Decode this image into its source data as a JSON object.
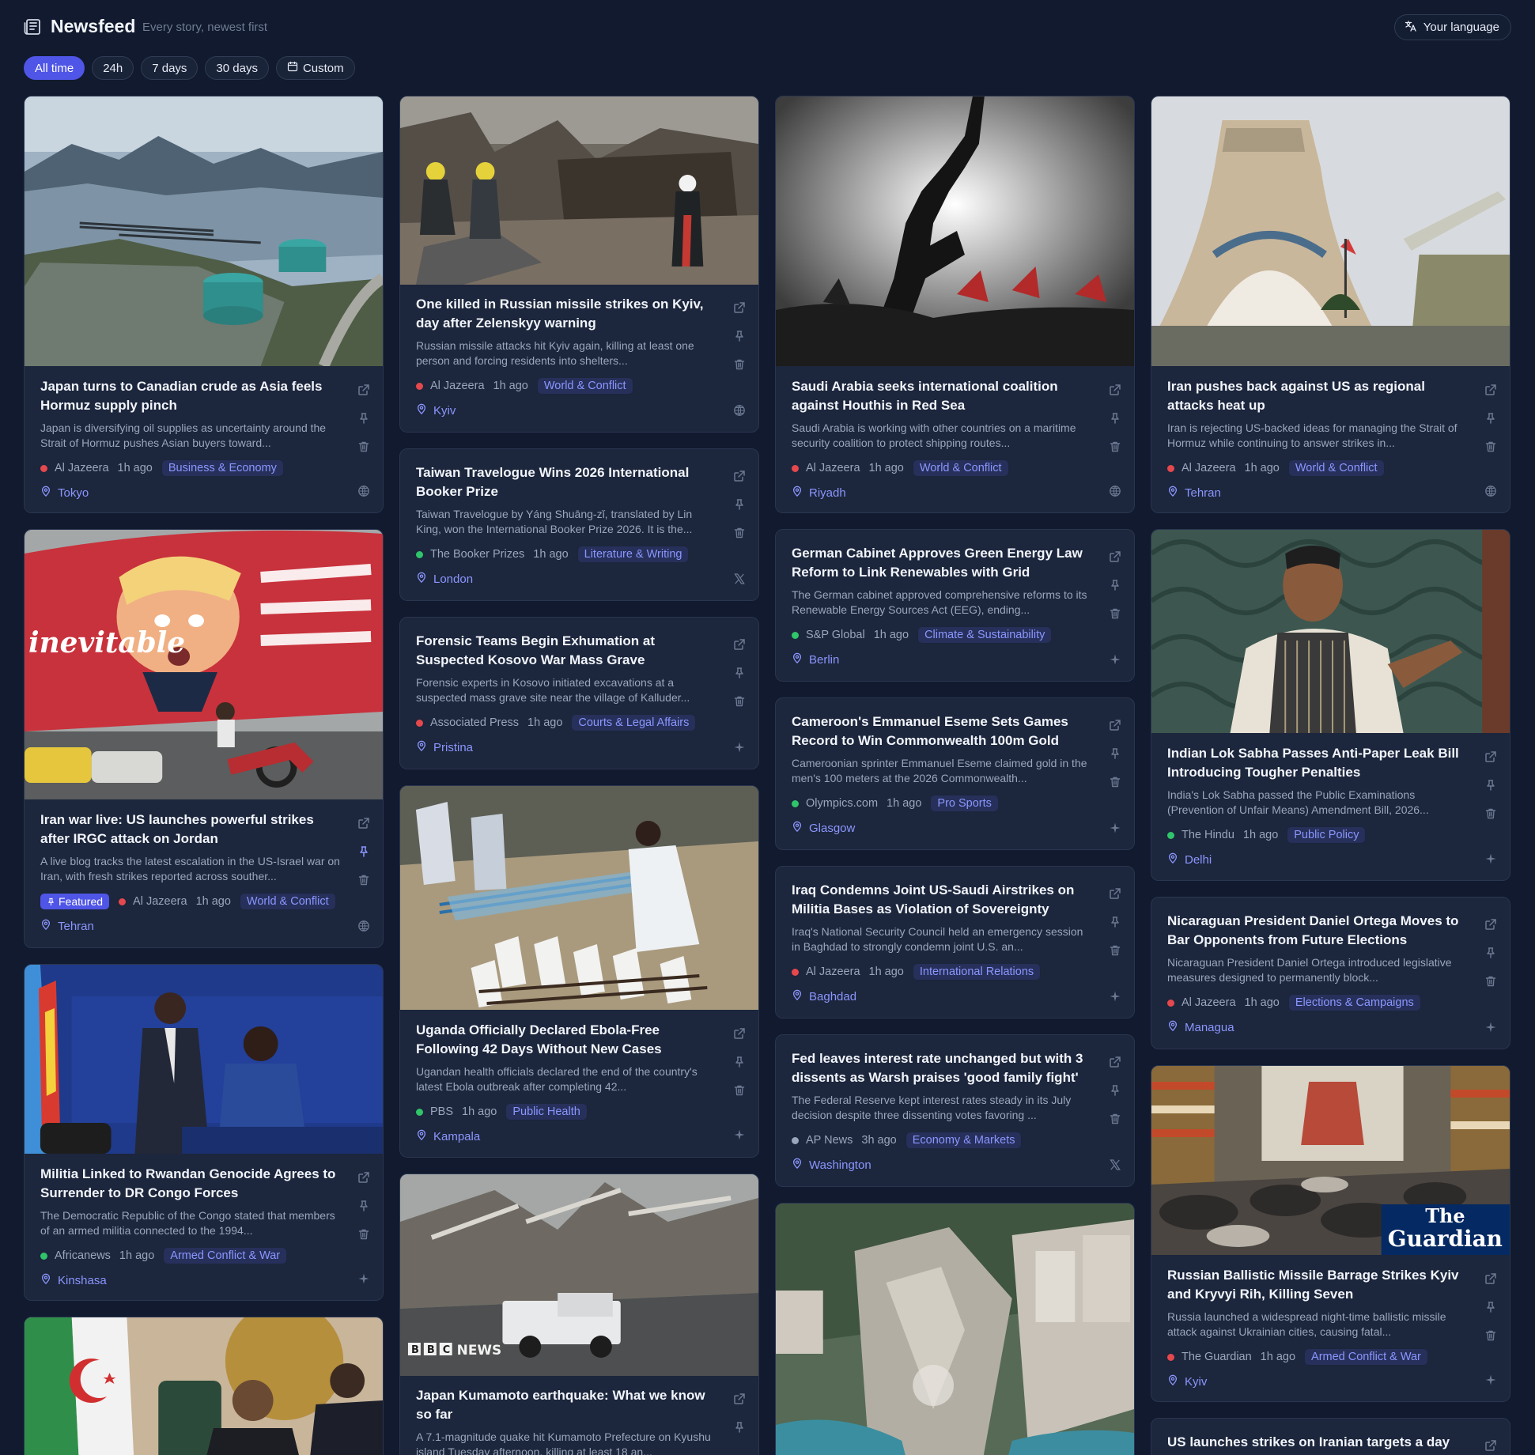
{
  "header": {
    "title": "Newsfeed",
    "subtitle": "Every story, newest first",
    "language_button": "Your language"
  },
  "filters": [
    "All time",
    "24h",
    "7 days",
    "30 days",
    "Custom"
  ],
  "active_filter": "All time",
  "cards": [
    {
      "title": "Japan turns to Canadian crude as Asia feels Hormuz supply pinch",
      "summary": "Japan is diversifying oil supplies as uncertainty around the Strait of Hormuz pushes Asian buyers toward...",
      "source": "Al Jazeera",
      "time": "1h ago",
      "category": "Business & Economy",
      "location": "Tokyo",
      "dot": "#e5484d"
    },
    {
      "title": "One killed in Russian missile strikes on Kyiv, day after Zelenskyy warning",
      "summary": "Russian missile attacks hit Kyiv again, killing at least one person and forcing residents into shelters...",
      "source": "Al Jazeera",
      "time": "1h ago",
      "category": "World & Conflict",
      "location": "Kyiv",
      "dot": "#e5484d"
    },
    {
      "title": "Saudi Arabia seeks international coalition against Houthis in Red Sea",
      "summary": "Saudi Arabia is working with other countries on a maritime security coalition to protect shipping routes...",
      "source": "Al Jazeera",
      "time": "1h ago",
      "category": "World & Conflict",
      "location": "Riyadh",
      "dot": "#e5484d"
    },
    {
      "title": "Iran pushes back against US as regional attacks heat up",
      "summary": "Iran is rejecting US-backed ideas for managing the Strait of Hormuz while continuing to answer strikes in...",
      "source": "Al Jazeera",
      "time": "1h ago",
      "category": "World & Conflict",
      "location": "Tehran",
      "dot": "#e5484d"
    },
    {
      "title": "Taiwan Travelogue Wins 2026 International Booker Prize",
      "summary": "Taiwan Travelogue by Yáng Shuāng-zǐ, translated by Lin King, won the International Booker Prize 2026. It is the...",
      "source": "The Booker Prizes",
      "time": "1h ago",
      "category": "Literature & Writing",
      "location": "London",
      "dot": "#30c46b"
    },
    {
      "title": "German Cabinet Approves Green Energy Law Reform to Link Renewables with Grid Capacity",
      "summary": "The German cabinet approved comprehensive reforms to its Renewable Energy Sources Act (EEG), ending...",
      "source": "S&P Global",
      "time": "1h ago",
      "category": "Climate & Sustainability",
      "location": "Berlin",
      "dot": "#30c46b"
    },
    {
      "title": "Iran war live: US launches powerful strikes after IRGC attack on Jordan",
      "summary": "A live blog tracks the latest escalation in the US-Israel war on Iran, with fresh strikes reported across souther...",
      "featured": "Featured",
      "source": "Al Jazeera",
      "time": "1h ago",
      "category": "World & Conflict",
      "location": "Tehran",
      "dot": "#e5484d"
    },
    {
      "title": "Forensic Teams Begin Exhumation at Suspected Kosovo War Mass Grave",
      "summary": "Forensic experts in Kosovo initiated excavations at a suspected mass grave site near the village of Kalluder...",
      "source": "Associated Press",
      "time": "1h ago",
      "category": "Courts & Legal Affairs",
      "location": "Pristina",
      "dot": "#e5484d"
    },
    {
      "title": "Cameroon's Emmanuel Eseme Sets Games Record to Win Commonwealth 100m Gold",
      "summary": "Cameroonian sprinter Emmanuel Eseme claimed gold in the men's 100 meters at the 2026 Commonwealth...",
      "source": "Olympics.com",
      "time": "1h ago",
      "category": "Pro Sports",
      "location": "Glasgow",
      "dot": "#30c46b"
    },
    {
      "title": "Indian Lok Sabha Passes Anti-Paper Leak Bill Introducing Tougher Penalties",
      "summary": "India's Lok Sabha passed the Public Examinations (Prevention of Unfair Means) Amendment Bill, 2026...",
      "source": "The Hindu",
      "time": "1h ago",
      "category": "Public Policy",
      "location": "Delhi",
      "dot": "#30c46b"
    },
    {
      "title": "Iraq Condemns Joint US-Saudi Airstrikes on Militia Bases as Violation of Sovereignty",
      "summary": "Iraq's National Security Council held an emergency session in Baghdad to strongly condemn joint U.S. an...",
      "source": "Al Jazeera",
      "time": "1h ago",
      "category": "International Relations",
      "location": "Baghdad",
      "dot": "#e5484d"
    },
    {
      "title": "Nicaraguan President Daniel Ortega Moves to Bar Opponents from Future Elections",
      "summary": "Nicaraguan President Daniel Ortega introduced legislative measures designed to permanently block...",
      "source": "Al Jazeera",
      "time": "1h ago",
      "category": "Elections & Campaigns",
      "location": "Managua",
      "dot": "#e5484d"
    },
    {
      "title": "Militia Linked to Rwandan Genocide Agrees to Surrender to DR Congo Forces",
      "summary": "The Democratic Republic of the Congo stated that members of an armed militia connected to the 1994...",
      "source": "Africanews",
      "time": "1h ago",
      "category": "Armed Conflict & War",
      "location": "Kinshasa",
      "dot": "#30c46b"
    },
    {
      "title": "Uganda Officially Declared Ebola-Free Following 42 Days Without New Cases",
      "summary": "Ugandan health officials declared the end of the country's latest Ebola outbreak after completing 42...",
      "source": "PBS",
      "time": "1h ago",
      "category": "Public Health",
      "location": "Kampala",
      "dot": "#30c46b"
    },
    {
      "title": "Fed leaves interest rate unchanged but with 3 dissents as Warsh praises 'good family fight'",
      "summary": "The Federal Reserve kept interest rates steady in its July decision despite three dissenting votes favoring ...",
      "source": "AP News",
      "time": "3h ago",
      "category": "Economy & Markets",
      "location": "Washington",
      "dot": "#9aa6bb"
    },
    {
      "title": "Russian Ballistic Missile Barrage Strikes Kyiv and Kryvyi Rih, Killing Seven",
      "summary": "Russia launched a widespread night-time ballistic missile attack against Ukrainian cities, causing fatal...",
      "source": "The Guardian",
      "time": "1h ago",
      "category": "Armed Conflict & War",
      "location": "Kyiv",
      "dot": "#e5484d"
    },
    {
      "title": "Japan Kumamoto earthquake: What we know so far",
      "summary": "A 7.1-magnitude quake hit Kumamoto Prefecture on Kyushu island Tuesday afternoon, killing at least 18 an..."
    },
    {
      "title": "US launches strikes on Iranian targets a day"
    }
  ],
  "image_texts": {
    "bbc": "BBC NEWS",
    "guardian_line1": "The",
    "guardian_line2": "Guardian"
  },
  "icons": [
    "newspaper-icon",
    "translate-icon",
    "calendar-icon",
    "external-link-icon",
    "pin-icon",
    "trash-icon",
    "location-pin-icon",
    "globe-icon",
    "sparkle-icon",
    "x-logo-icon"
  ]
}
